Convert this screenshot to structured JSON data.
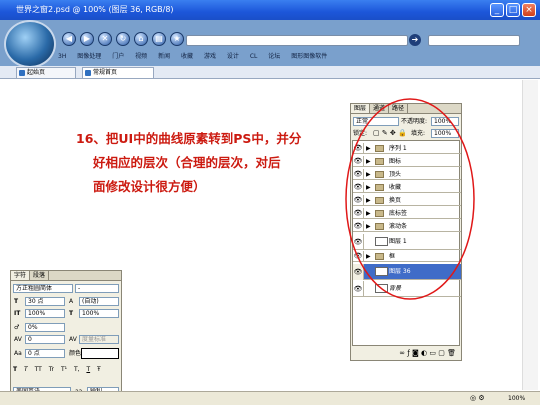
{
  "window": {
    "title": "世界之窗2.psd @ 100% (图层 36, RGB/8)",
    "minimize_glyph": "_",
    "maximize_glyph": "□",
    "close_glyph": "×"
  },
  "toolbar": {
    "buttons": [
      "back-icon",
      "forward-icon",
      "stop-icon",
      "refresh-icon",
      "home-icon",
      "print-icon",
      "favorites-icon"
    ],
    "go_glyph": "➔",
    "favorites": [
      "3H",
      "图像处理",
      "门户",
      "视频",
      "新闻",
      "收藏",
      "游戏",
      "设计",
      "CL",
      "论坛",
      "图形图像软件"
    ]
  },
  "tabs": [
    {
      "label": "起始页"
    },
    {
      "label": "常规首页"
    }
  ],
  "instruction": {
    "lines": [
      "16、把UI中的曲线原素转到PS中，并分",
      "好相应的层次（合理的层次，对后",
      "面修改设计很方便）"
    ]
  },
  "layers_panel": {
    "tabs": [
      "图层",
      "通道",
      "路径"
    ],
    "blend_mode": "正常",
    "opacity_label": "不透明度:",
    "opacity_value": "100%",
    "lock_label": "锁定:",
    "fill_label": "填充:",
    "fill_value": "100%",
    "layers": [
      {
        "name": "序列 1",
        "type": "group"
      },
      {
        "name": "图标",
        "type": "group"
      },
      {
        "name": "顶头",
        "type": "group"
      },
      {
        "name": "收藏",
        "type": "group"
      },
      {
        "name": "换页",
        "type": "group"
      },
      {
        "name": "底标签",
        "type": "group"
      },
      {
        "name": "滚动条",
        "type": "group"
      },
      {
        "name": "图层 1",
        "type": "layer"
      },
      {
        "name": "框",
        "type": "group"
      },
      {
        "name": "图层 36",
        "type": "layer",
        "selected": true
      },
      {
        "name": "背景",
        "type": "background"
      }
    ],
    "footer_icons": [
      "link-icon",
      "style-icon",
      "mask-icon",
      "adjust-icon",
      "new-group-icon",
      "new-layer-icon",
      "trash-icon"
    ]
  },
  "char_panel": {
    "tabs": [
      "字符",
      "段落"
    ],
    "font_family": "方正粗圆简体",
    "font_style": "-",
    "font_size": "30 点",
    "leading": "(自动)",
    "vscale": "100%",
    "hscale": "100%",
    "baseline": "0%",
    "tracking": "0",
    "kerning_label": "度量标准",
    "shift": "0 点",
    "color_label": "颜色:",
    "style_buttons": [
      "T",
      "T",
      "TT",
      "Tr",
      "T¹",
      "T,",
      "T",
      "Ŧ"
    ],
    "language": "美国英语",
    "aa_label": "aa",
    "antialias": "锐利"
  },
  "status": {
    "zoom": "100%"
  }
}
